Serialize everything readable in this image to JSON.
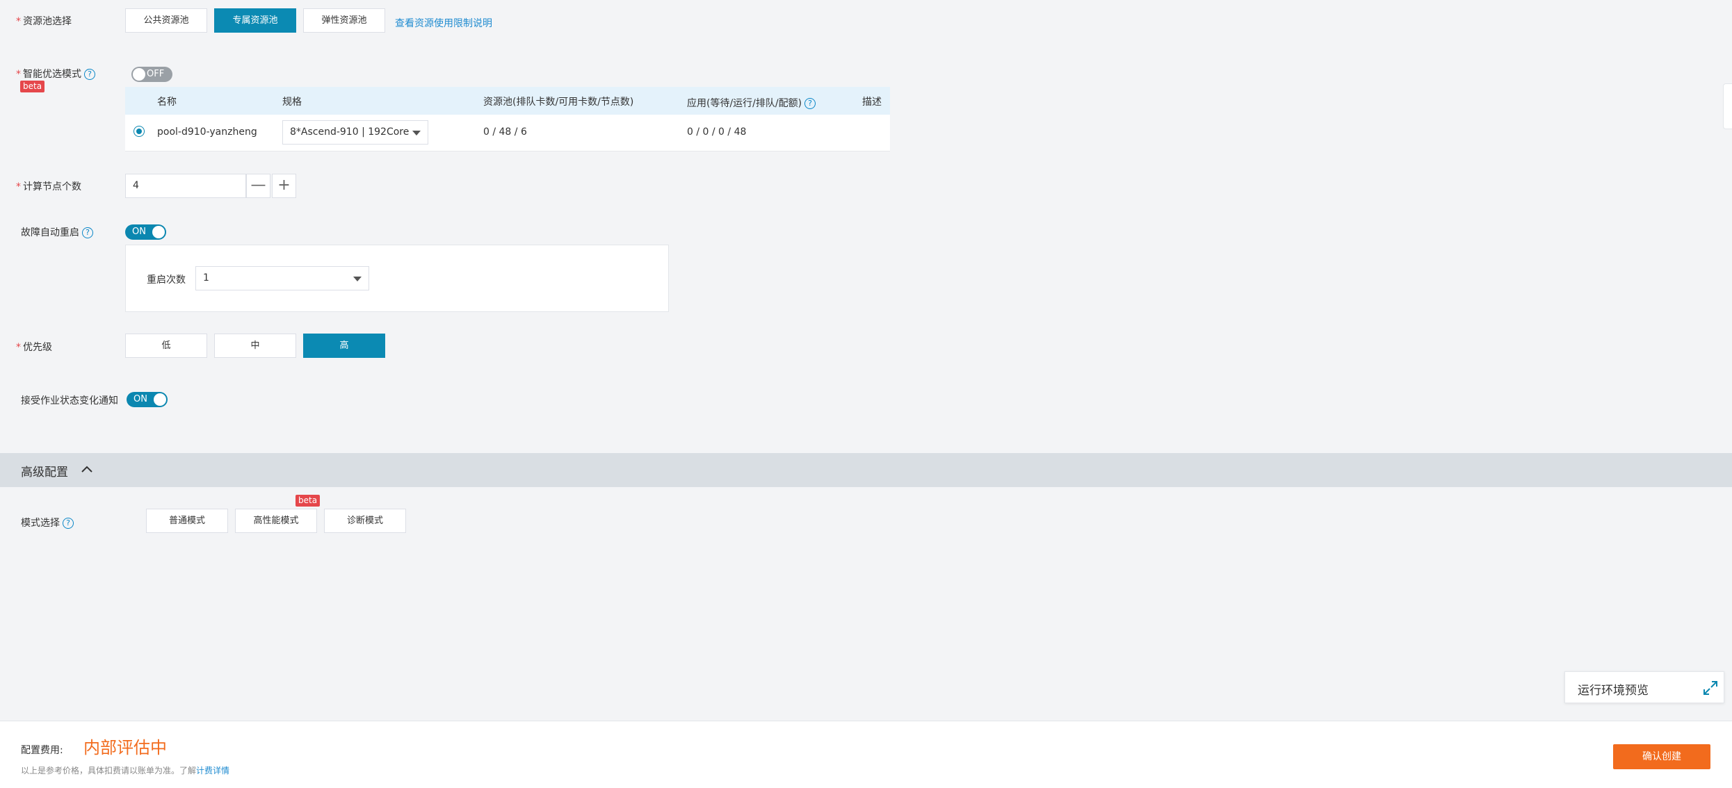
{
  "resource_pool": {
    "label": "资源池选择",
    "options": [
      "公共资源池",
      "专属资源池",
      "弹性资源池"
    ],
    "selected": "专属资源池",
    "limit_link": "查看资源使用限制说明"
  },
  "smart_select": {
    "label": "智能优选模式",
    "badge": "beta",
    "toggle_text": "OFF"
  },
  "pool_table": {
    "headers": [
      "名称",
      "规格",
      "资源池(排队卡数/可用卡数/节点数)",
      "应用(等待/运行/排队/配额)",
      "描述"
    ],
    "rows": [
      {
        "name": "pool-d910-yanzheng",
        "spec": "8*Ascend-910 | 192Core",
        "pool": "0 / 48 / 6",
        "app": "0 / 0 / 0 / 48",
        "desc": ""
      }
    ]
  },
  "node_count": {
    "label": "计算节点个数",
    "value": "4",
    "minus": "—",
    "plus": "+"
  },
  "auto_restart": {
    "label": "故障自动重启",
    "toggle_text": "ON",
    "restart_label": "重启次数",
    "restart_value": "1"
  },
  "priority": {
    "label": "优先级",
    "options": [
      "低",
      "中",
      "高"
    ],
    "selected": "高"
  },
  "notify": {
    "label": "接受作业状态变化通知",
    "toggle_text": "ON"
  },
  "advanced": {
    "title": "高级配置",
    "mode_label": "模式选择",
    "modes": [
      "普通模式",
      "高性能模式",
      "诊断模式"
    ],
    "mode_badge": "beta"
  },
  "preview": {
    "label": "运行环境预览"
  },
  "footer": {
    "fee_label": "配置费用:",
    "fee_value": "内部评估中",
    "note": "以上是参考价格，具体扣费请以账单为准。了解",
    "note_link": "计费详情",
    "confirm": "确认创建"
  },
  "colors": {
    "primary": "#0b8ab3",
    "accent": "#f26b1d",
    "danger": "#e5474b",
    "link": "#1f8bd0"
  }
}
